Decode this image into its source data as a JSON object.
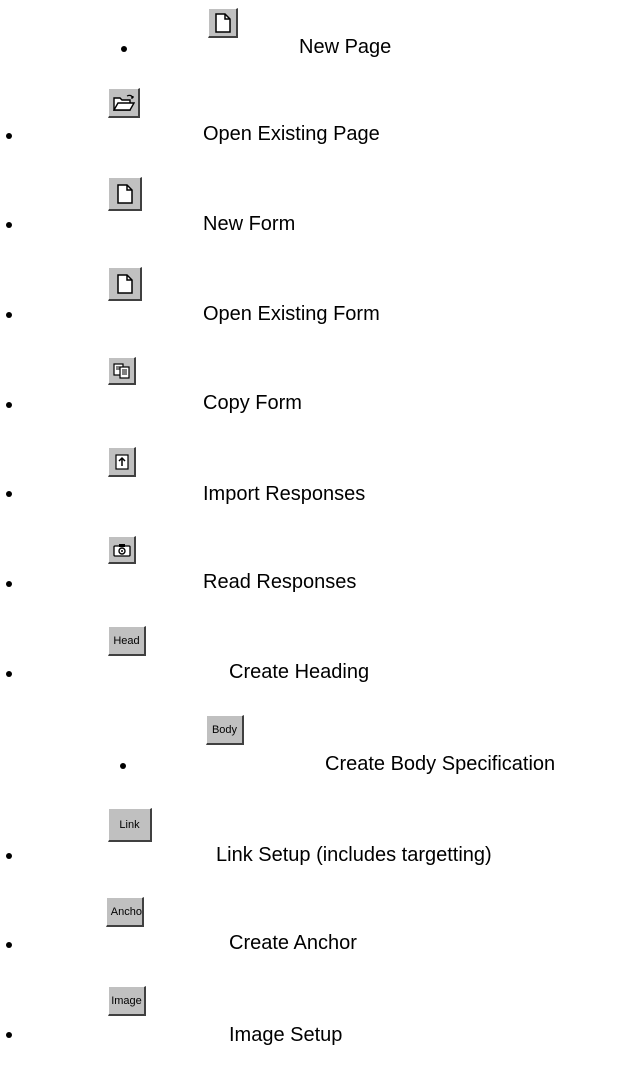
{
  "items": [
    {
      "icon": "new-page-icon",
      "button_text": "",
      "label": "New Page"
    },
    {
      "icon": "open-folder-icon",
      "button_text": "",
      "label": "Open Existing Page"
    },
    {
      "icon": "new-form-icon",
      "button_text": "",
      "label": "New Form"
    },
    {
      "icon": "open-form-icon",
      "button_text": "",
      "label": "Open Existing Form"
    },
    {
      "icon": "copy-icon",
      "button_text": "",
      "label": "Copy Form"
    },
    {
      "icon": "import-arrow-icon",
      "button_text": "",
      "label": "Import Responses"
    },
    {
      "icon": "camera-icon",
      "button_text": "",
      "label": "Read Responses"
    },
    {
      "icon": "head-button-icon",
      "button_text": "Head",
      "label": "Create Heading"
    },
    {
      "icon": "body-button-icon",
      "button_text": "Body",
      "label": "Create Body Specification"
    },
    {
      "icon": "link-button-icon",
      "button_text": "Link",
      "label": "Link Setup (includes targetting)"
    },
    {
      "icon": "anchor-button-icon",
      "button_text": "Ancho",
      "label": "Create Anchor"
    },
    {
      "icon": "image-button-icon",
      "button_text": "Image",
      "label": "Image Setup"
    }
  ]
}
